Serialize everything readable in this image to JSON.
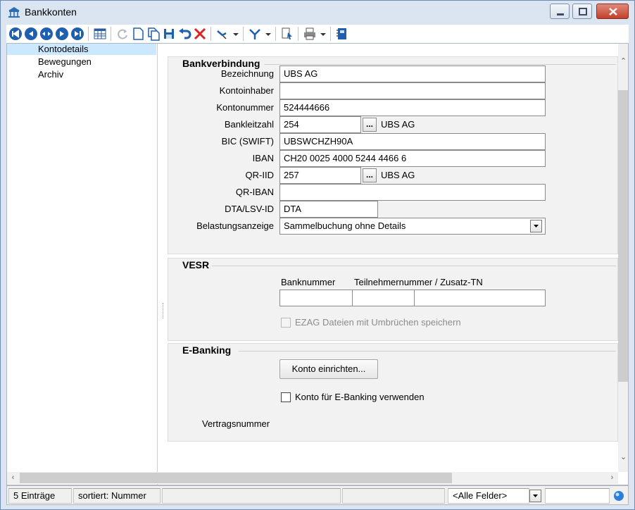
{
  "window": {
    "title": "Bankkonten"
  },
  "toolbar": {
    "buttons": [
      "first-record-icon",
      "previous-record-icon",
      "record-list-icon",
      "next-record-icon",
      "last-record-icon",
      "table-view-icon",
      "refresh-icon",
      "new-record-icon",
      "copy-record-icon",
      "save-icon",
      "undo-icon",
      "delete-icon",
      "filter-select-icon",
      "filter-funnel-icon",
      "export-icon",
      "print-icon",
      "notes-icon"
    ]
  },
  "nav": {
    "items": [
      {
        "label": "Kontodetails",
        "selected": true
      },
      {
        "label": "Bewegungen",
        "selected": false
      },
      {
        "label": "Archiv",
        "selected": false
      }
    ]
  },
  "bank": {
    "title": "Bankverbindung",
    "bezeichnung_label": "Bezeichnung",
    "bezeichnung_value": "UBS AG",
    "kontoinhaber_label": "Kontoinhaber",
    "kontoinhaber_value": "",
    "kontonummer_label": "Kontonummer",
    "kontonummer_value": "524444666",
    "bankleitzahl_label": "Bankleitzahl",
    "bankleitzahl_value": "254",
    "bankleitzahl_bank": "UBS AG",
    "bic_label": "BIC (SWIFT)",
    "bic_value": "UBSWCHZH90A",
    "iban_label": "IBAN",
    "iban_value": "CH20 0025 4000 5244 4466 6",
    "qriid_label": "QR-IID",
    "qriid_value": "257",
    "qriid_bank": "UBS AG",
    "qriban_label": "QR-IBAN",
    "qriban_value": "",
    "dta_label": "DTA/LSV-ID",
    "dta_value": "DTA",
    "belastung_label": "Belastungsanzeige",
    "belastung_value": "Sammelbuchung ohne Details",
    "dots": "..."
  },
  "vesr": {
    "title": "VESR",
    "banknummer_label": "Banknummer",
    "teilnehmer_label": "Teilnehmernummer / Zusatz-TN",
    "ezag_label": "EZAG Dateien mit Umbrüchen speichern",
    "ezag_checked": false
  },
  "ebanking": {
    "title": "E-Banking",
    "setup_button": "Konto einrichten...",
    "use_label": "Konto für E-Banking verwenden",
    "use_checked": false,
    "vertrag_label": "Vertragsnummer"
  },
  "status": {
    "count": "5 Einträge",
    "sort": "sortiert: Nummer",
    "field_filter": "<Alle Felder>"
  }
}
